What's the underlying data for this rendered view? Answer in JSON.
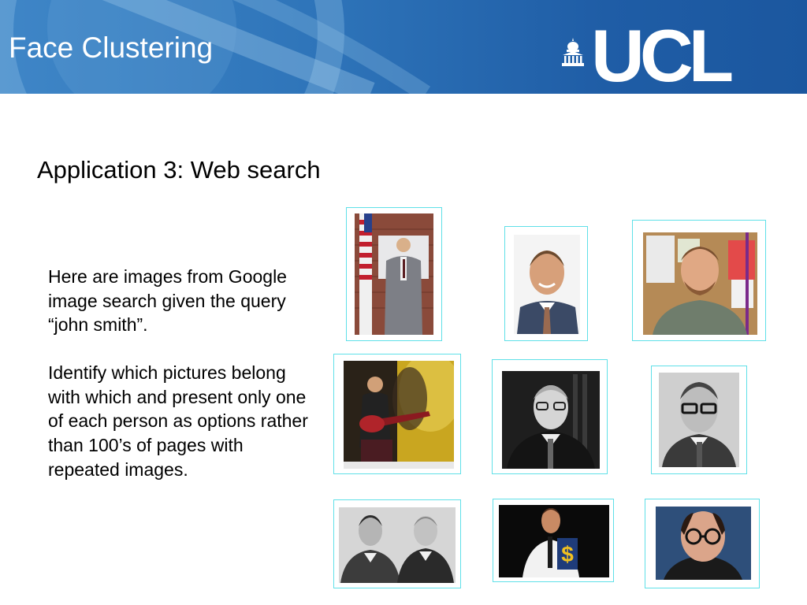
{
  "header": {
    "title": "Face Clustering",
    "logo_text": "UCL"
  },
  "content": {
    "subtitle": "Application 3:  Web search",
    "paragraph_1": "Here are images from Google image search given the query “john smith”.",
    "paragraph_2": "Identify which pictures belong with which and present only one of each person as options rather than 100’s of pages with repeated images."
  },
  "colors": {
    "banner": "#2e74b9",
    "photo_border": "#5fe0e8",
    "text": "#000000"
  }
}
